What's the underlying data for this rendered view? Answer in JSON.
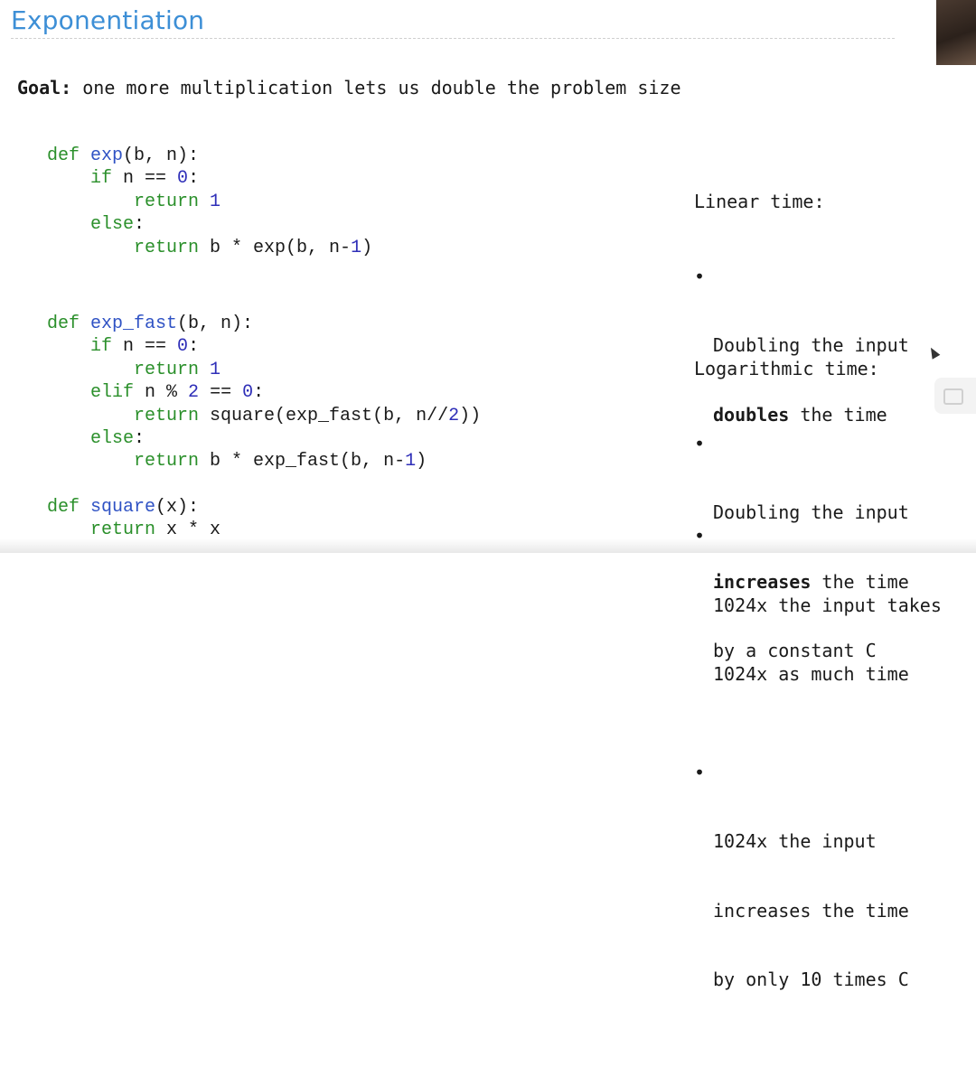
{
  "slide": {
    "title": "Exponentiation",
    "goal_label": "Goal:",
    "goal_text": " one more multiplication lets us double the problem size"
  },
  "code_blocks": [
    {
      "id": "exp",
      "lines": [
        [
          [
            "kw",
            "def "
          ],
          [
            "fn",
            "exp"
          ],
          [
            "op",
            "(b, n):"
          ]
        ],
        [
          [
            "op",
            "    "
          ],
          [
            "kw",
            "if"
          ],
          [
            "op",
            " n == "
          ],
          [
            "num",
            "0"
          ],
          [
            "op",
            ":"
          ]
        ],
        [
          [
            "op",
            "        "
          ],
          [
            "kw",
            "return "
          ],
          [
            "num",
            "1"
          ]
        ],
        [
          [
            "op",
            "    "
          ],
          [
            "kw",
            "else"
          ],
          [
            "op",
            ":"
          ]
        ],
        [
          [
            "op",
            "        "
          ],
          [
            "kw",
            "return"
          ],
          [
            "op",
            " b * exp(b, n-"
          ],
          [
            "num",
            "1"
          ],
          [
            "op",
            ")"
          ]
        ]
      ]
    },
    {
      "id": "exp_fast",
      "lines": [
        [
          [
            "kw",
            "def "
          ],
          [
            "fn",
            "exp_fast"
          ],
          [
            "op",
            "(b, n):"
          ]
        ],
        [
          [
            "op",
            "    "
          ],
          [
            "kw",
            "if"
          ],
          [
            "op",
            " n == "
          ],
          [
            "num",
            "0"
          ],
          [
            "op",
            ":"
          ]
        ],
        [
          [
            "op",
            "        "
          ],
          [
            "kw",
            "return "
          ],
          [
            "num",
            "1"
          ]
        ],
        [
          [
            "op",
            "    "
          ],
          [
            "kw",
            "elif"
          ],
          [
            "op",
            " n % "
          ],
          [
            "num",
            "2"
          ],
          [
            "op",
            " == "
          ],
          [
            "num",
            "0"
          ],
          [
            "op",
            ":"
          ]
        ],
        [
          [
            "op",
            "        "
          ],
          [
            "kw",
            "return"
          ],
          [
            "op",
            " square(exp_fast(b, n//"
          ],
          [
            "num",
            "2"
          ],
          [
            "op",
            "))"
          ]
        ],
        [
          [
            "op",
            "    "
          ],
          [
            "kw",
            "else"
          ],
          [
            "op",
            ":"
          ]
        ],
        [
          [
            "op",
            "        "
          ],
          [
            "kw",
            "return"
          ],
          [
            "op",
            " b * exp_fast(b, n-"
          ],
          [
            "num",
            "1"
          ],
          [
            "op",
            ")"
          ]
        ]
      ]
    },
    {
      "id": "square",
      "lines": [
        [
          [
            "kw",
            "def "
          ],
          [
            "fn",
            "square"
          ],
          [
            "op",
            "(x):"
          ]
        ],
        [
          [
            "op",
            "    "
          ],
          [
            "kw",
            "return"
          ],
          [
            "op",
            " x * x"
          ]
        ]
      ]
    }
  ],
  "linear": {
    "heading": "Linear time:",
    "b1_l1": "Doubling the input",
    "b1_bold": "doubles",
    "b1_rest": " the time",
    "b2_l1": "1024x the input takes",
    "b2_l2": "1024x as much time"
  },
  "logarithmic": {
    "heading": "Logarithmic time:",
    "b1_l1": "Doubling the input",
    "b1_bold": "increases",
    "b1_rest": " the time",
    "b1_l3": "by a constant C",
    "b2_l1": "1024x the input",
    "b2_l2": "increases the time",
    "b2_l3": "by only 10 times C"
  },
  "bullet_char": "•",
  "colors": {
    "title": "#3d8fd6",
    "keyword": "#2a8f2a",
    "function_name": "#2f52c4",
    "number": "#2f2fb8"
  }
}
